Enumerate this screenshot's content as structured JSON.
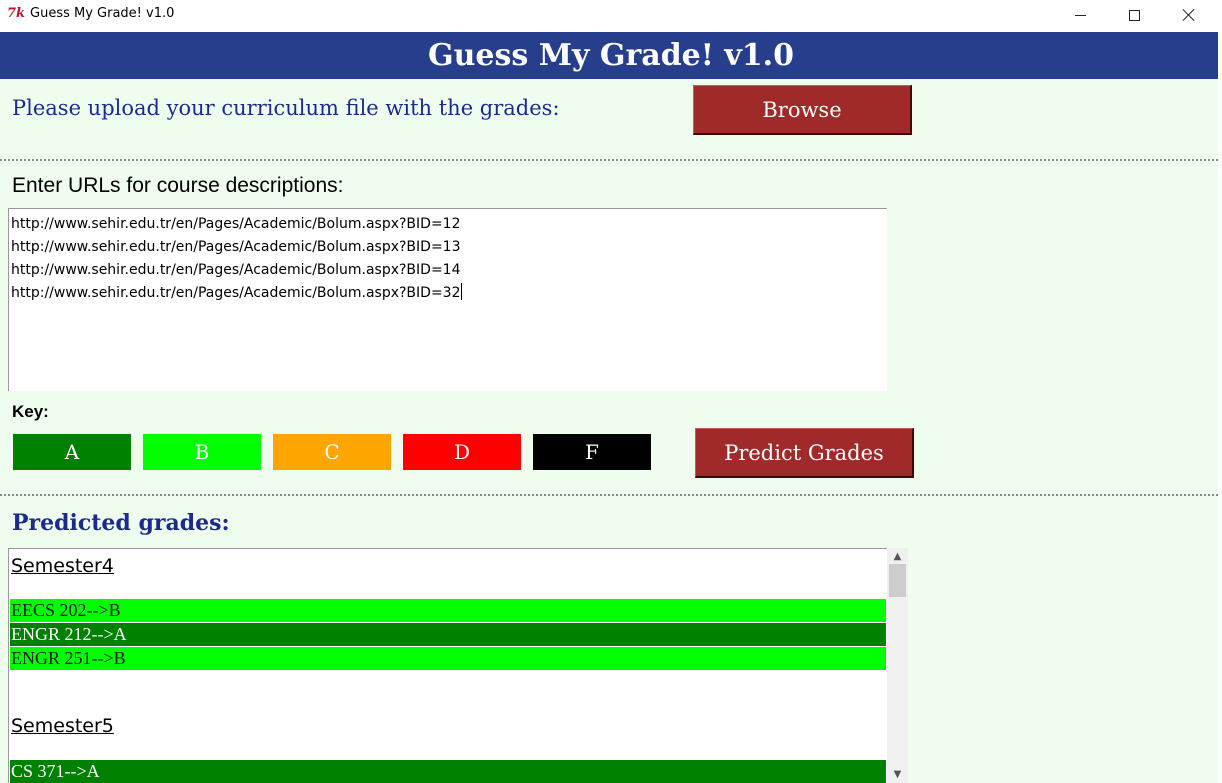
{
  "window": {
    "title": "Guess My Grade! v1.0",
    "icon": "tk-feather-icon"
  },
  "header": {
    "title": "Guess My Grade! v1.0"
  },
  "upload": {
    "label": "Please upload your curriculum file with the grades:",
    "browse_label": "Browse"
  },
  "urls": {
    "label": "Enter URLs for course descriptions:",
    "lines": [
      "http://www.sehir.edu.tr/en/Pages/Academic/Bolum.aspx?BID=12",
      "http://www.sehir.edu.tr/en/Pages/Academic/Bolum.aspx?BID=13",
      "http://www.sehir.edu.tr/en/Pages/Academic/Bolum.aspx?BID=14",
      "http://www.sehir.edu.tr/en/Pages/Academic/Bolum.aspx?BID=32"
    ]
  },
  "key": {
    "label": "Key:",
    "grades": [
      {
        "grade": "A",
        "bg": "#008000",
        "fg": "#ffffff"
      },
      {
        "grade": "B",
        "bg": "#00ff00",
        "fg": "#ffffff"
      },
      {
        "grade": "C",
        "bg": "#ffa500",
        "fg": "#ffffff"
      },
      {
        "grade": "D",
        "bg": "#ff0000",
        "fg": "#ffffff"
      },
      {
        "grade": "F",
        "bg": "#000000",
        "fg": "#ffffff"
      }
    ]
  },
  "predict": {
    "button_label": "Predict Grades"
  },
  "results": {
    "label": "Predicted grades:",
    "semesters": [
      {
        "title": "Semester4",
        "courses": [
          {
            "text": "EECS 202-->B",
            "grade": "B"
          },
          {
            "text": "ENGR 212-->A",
            "grade": "A"
          },
          {
            "text": "ENGR 251-->B",
            "grade": "B"
          }
        ]
      },
      {
        "title": "Semester5",
        "courses": [
          {
            "text": "CS 371-->A",
            "grade": "A"
          }
        ]
      }
    ]
  },
  "colors": {
    "banner": "#263e8b",
    "background": "#effdef",
    "button": "#a02a2a",
    "label_blue": "#1c2a8f",
    "grade_A": "#008000",
    "grade_B": "#00ff00"
  }
}
